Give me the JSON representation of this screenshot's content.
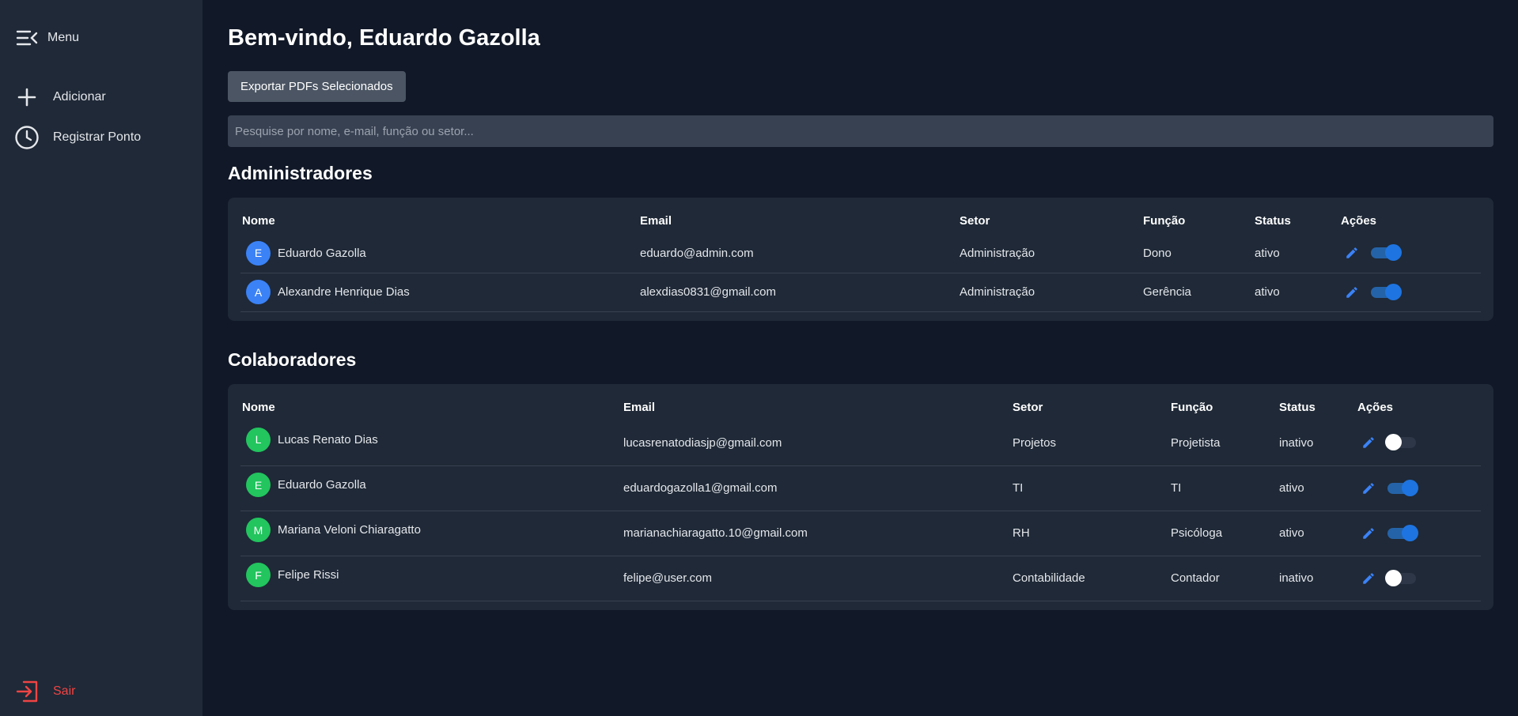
{
  "sidebar": {
    "menu_label": "Menu",
    "add_label": "Adicionar",
    "clock_label": "Registrar Ponto",
    "logout_label": "Sair"
  },
  "main": {
    "title": "Bem-vindo, Eduardo Gazolla",
    "export_label": "Exportar PDFs Selecionados",
    "search_placeholder": "Pesquise por nome, e-mail, função ou setor..."
  },
  "columns": {
    "nome": "Nome",
    "email": "Email",
    "setor": "Setor",
    "funcao": "Função",
    "status": "Status",
    "acoes": "Ações"
  },
  "admins": {
    "title": "Administradores",
    "rows": [
      {
        "initial": "E",
        "name": "Eduardo Gazolla",
        "email": "eduardo@admin.com",
        "setor": "Administração",
        "funcao": "Dono",
        "status": "ativo",
        "active": true
      },
      {
        "initial": "A",
        "name": "Alexandre Henrique Dias",
        "email": "alexdias0831@gmail.com",
        "setor": "Administração",
        "funcao": "Gerência",
        "status": "ativo",
        "active": true
      }
    ]
  },
  "collaborators": {
    "title": "Colaboradores",
    "rows": [
      {
        "initial": "L",
        "name": "Lucas Renato Dias",
        "email": "lucasrenatodiasjp@gmail.com",
        "setor": "Projetos",
        "funcao": "Projetista",
        "status": "inativo",
        "active": false
      },
      {
        "initial": "E",
        "name": "Eduardo Gazolla",
        "email": "eduardogazolla1@gmail.com",
        "setor": "TI",
        "funcao": "TI",
        "status": "ativo",
        "active": true
      },
      {
        "initial": "M",
        "name": "Mariana Veloni Chiaragatto",
        "email": "marianachiaragatto.10@gmail.com",
        "setor": "RH",
        "funcao": "Psicóloga",
        "status": "ativo",
        "active": true
      },
      {
        "initial": "F",
        "name": "Felipe Rissi",
        "email": "felipe@user.com",
        "setor": "Contabilidade",
        "funcao": "Contador",
        "status": "inativo",
        "active": false
      }
    ]
  },
  "colors": {
    "admin_avatar": "#3b82f6",
    "collab_avatar": "#22c55e",
    "logout": "#ef4444",
    "edit_icon": "#3b82f6"
  },
  "icons": {
    "menu": "menu-collapse-icon",
    "add": "plus-icon",
    "clock": "clock-icon",
    "logout": "logout-icon",
    "edit": "pencil-icon"
  }
}
